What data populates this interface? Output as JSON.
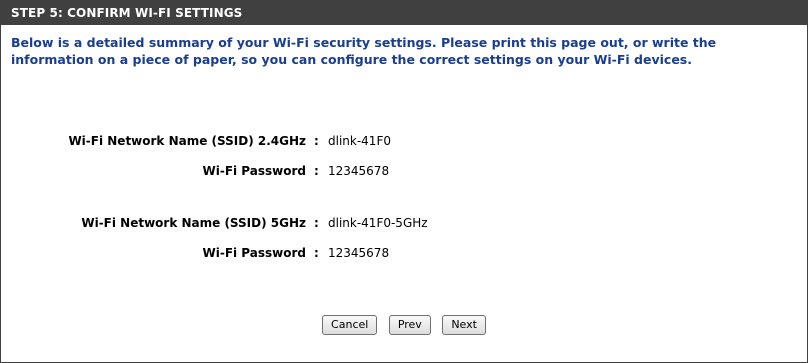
{
  "header": {
    "title": "STEP 5: CONFIRM WI-FI SETTINGS"
  },
  "intro": {
    "text": "Below is a detailed summary of your Wi-Fi security settings. Please print this page out, or write the information on a piece of paper, so you can configure the correct settings on your Wi-Fi devices."
  },
  "settings": {
    "ssid_24_label": "Wi-Fi Network Name (SSID) 2.4GHz",
    "ssid_24_value": "dlink-41F0",
    "password_24_label": "Wi-Fi Password",
    "password_24_value": "12345678",
    "ssid_5_label": "Wi-Fi Network Name (SSID) 5GHz",
    "ssid_5_value": "dlink-41F0-5GHz",
    "password_5_label": "Wi-Fi Password",
    "password_5_value": "12345678",
    "separator": ":"
  },
  "buttons": {
    "cancel": "Cancel",
    "prev": "Prev",
    "next": "Next"
  }
}
